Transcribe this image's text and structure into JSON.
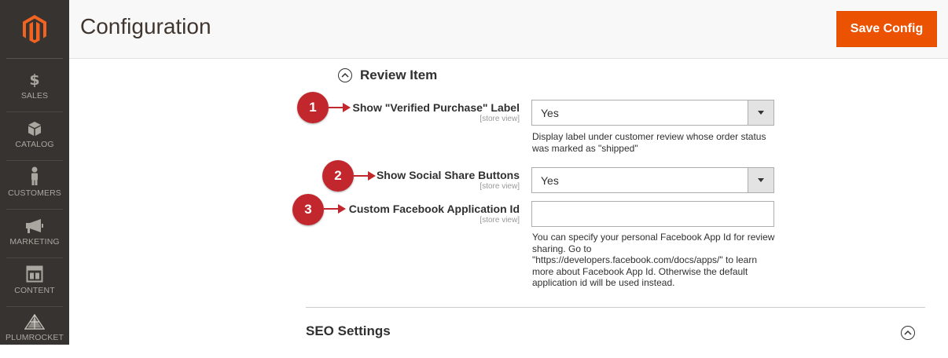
{
  "sidebar": {
    "items": [
      {
        "label": "SALES",
        "icon": "dollar-icon"
      },
      {
        "label": "CATALOG",
        "icon": "box-icon"
      },
      {
        "label": "CUSTOMERS",
        "icon": "person-icon"
      },
      {
        "label": "MARKETING",
        "icon": "megaphone-icon"
      },
      {
        "label": "CONTENT",
        "icon": "layout-icon"
      },
      {
        "label": "PLUMROCKET",
        "icon": "pyramid-icon"
      }
    ]
  },
  "header": {
    "title": "Configuration",
    "save_label": "Save Config"
  },
  "section": {
    "title": "Review Item"
  },
  "fields": [
    {
      "label": "Show \"Verified Purchase\" Label",
      "scope": "[store view]",
      "value": "Yes",
      "note": "Display label under customer review whose order status was marked as \"shipped\"",
      "badge": "1"
    },
    {
      "label": "Show Social Share Buttons",
      "scope": "[store view]",
      "value": "Yes",
      "badge": "2"
    },
    {
      "label": "Custom Facebook Application Id",
      "scope": "[store view]",
      "value": "",
      "note": "You can specify your personal Facebook App Id for review sharing. Go to \"https://developers.facebook.com/docs/apps/\" to learn more about Facebook App Id. Otherwise the default application id will be used instead.",
      "badge": "3"
    }
  ],
  "next_section": {
    "title": "SEO Settings"
  },
  "colors": {
    "accent": "#eb5202",
    "badge": "#c1272d",
    "sidebar": "#373330"
  }
}
